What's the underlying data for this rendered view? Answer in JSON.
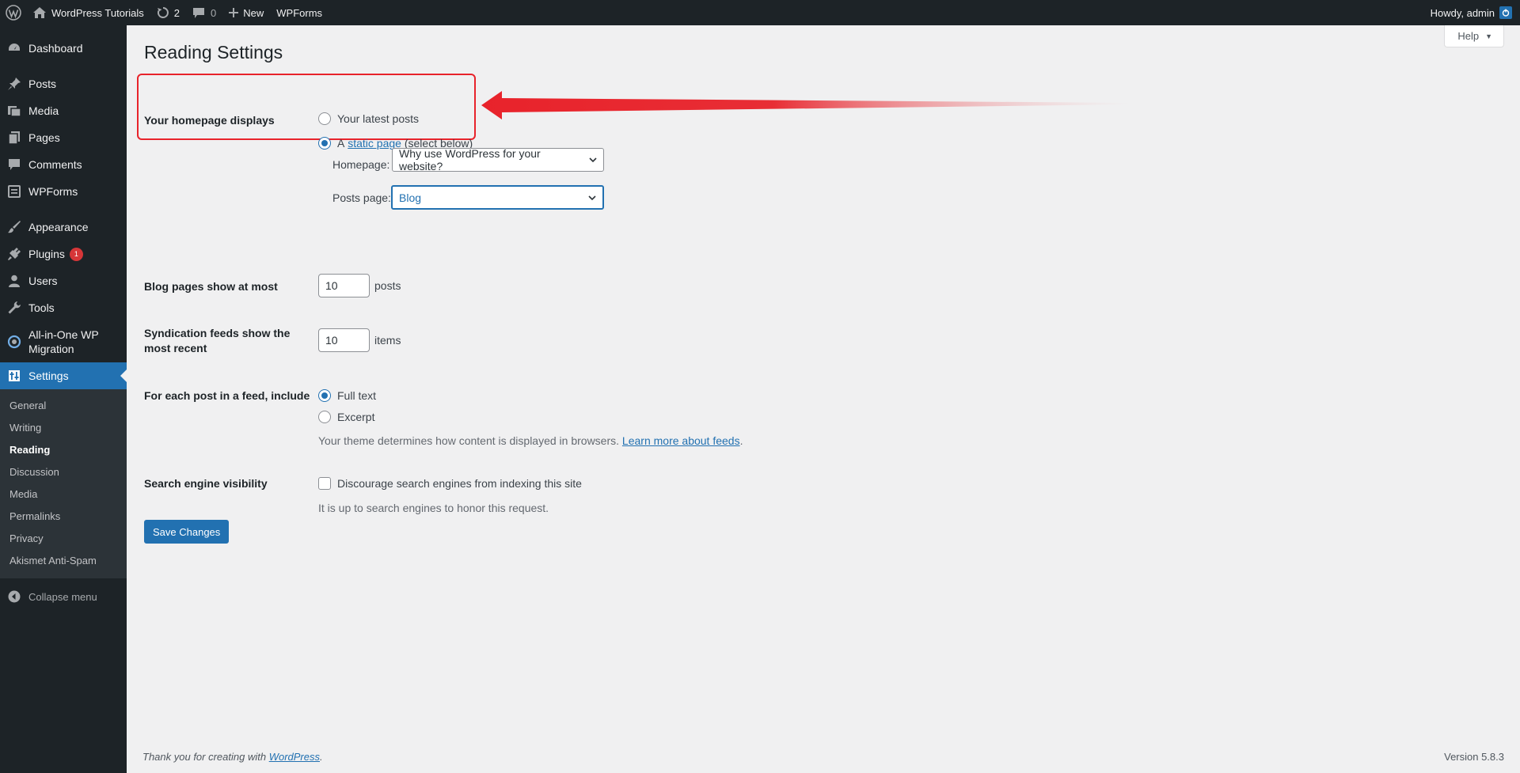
{
  "adminbar": {
    "site_name": "WordPress Tutorials",
    "updates_count": "2",
    "comments_count": "0",
    "new_label": "New",
    "wpforms_label": "WPForms",
    "greeting": "Howdy, admin"
  },
  "sidebar": {
    "items": [
      {
        "label": "Dashboard",
        "icon": "dashboard-icon"
      },
      {
        "label": "Posts",
        "icon": "pin-icon"
      },
      {
        "label": "Media",
        "icon": "media-icon"
      },
      {
        "label": "Pages",
        "icon": "pages-icon"
      },
      {
        "label": "Comments",
        "icon": "comment-icon"
      },
      {
        "label": "WPForms",
        "icon": "forms-icon"
      },
      {
        "label": "Appearance",
        "icon": "brush-icon"
      },
      {
        "label": "Plugins",
        "icon": "plugin-icon",
        "badge": "1"
      },
      {
        "label": "Users",
        "icon": "user-icon"
      },
      {
        "label": "Tools",
        "icon": "wrench-icon"
      },
      {
        "label": "All-in-One WP Migration",
        "icon": "migration-icon"
      },
      {
        "label": "Settings",
        "icon": "settings-icon"
      }
    ],
    "submenu": [
      "General",
      "Writing",
      "Reading",
      "Discussion",
      "Media",
      "Permalinks",
      "Privacy",
      "Akismet Anti-Spam"
    ],
    "collapse_label": "Collapse menu"
  },
  "help_label": "Help",
  "page_title": "Reading Settings",
  "homepage_displays": {
    "label": "Your homepage displays",
    "option_latest": "Your latest posts",
    "option_static_prefix": "A",
    "option_static_link": "static page",
    "option_static_suffix": "(select below)",
    "selected": "static page"
  },
  "homepage_select": {
    "label": "Homepage:",
    "value": "Why use WordPress for your website?"
  },
  "posts_page_select": {
    "label": "Posts page:",
    "value": "Blog"
  },
  "blog_pages": {
    "label": "Blog pages show at most",
    "value": "10",
    "unit": "posts"
  },
  "syndication": {
    "label_line1": "Syndication feeds show the",
    "label_line2": "most recent",
    "value": "10",
    "unit": "items"
  },
  "feed_include": {
    "label": "For each post in a feed, include",
    "option_full": "Full text",
    "option_excerpt": "Excerpt",
    "selected": "Full text",
    "description": "Your theme determines how content is displayed in browsers.",
    "description_link": "Learn more about feeds",
    "description_end": "."
  },
  "search_visibility": {
    "label": "Search engine visibility",
    "checkbox_label": "Discourage search engines from indexing this site",
    "checked": false,
    "description": "It is up to search engines to honor this request."
  },
  "save_label": "Save Changes",
  "footer": {
    "thanks_prefix": "Thank you for creating with",
    "thanks_link": "WordPress",
    "thanks_suffix": ".",
    "version": "Version 5.8.3"
  },
  "colors": {
    "accent": "#2271b1",
    "admin_bg": "#1d2327",
    "highlight": "#e8232b"
  }
}
